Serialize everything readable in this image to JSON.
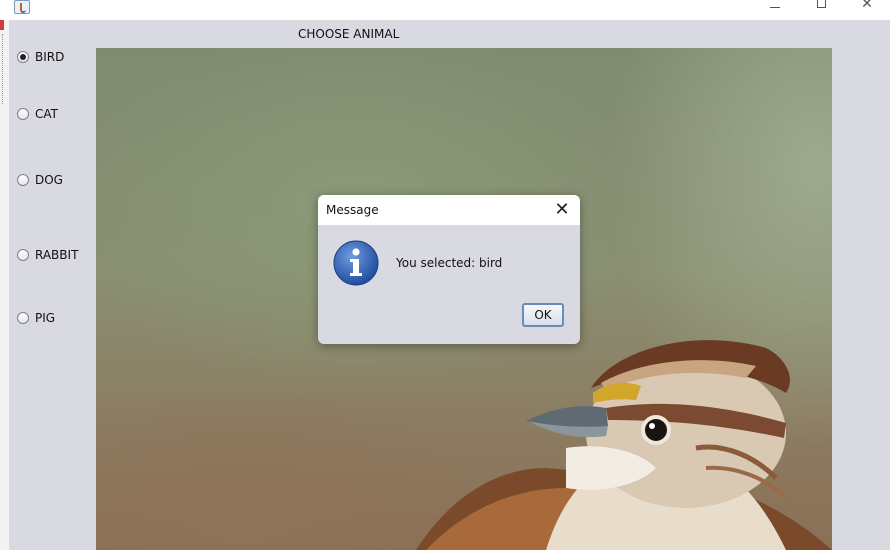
{
  "window": {
    "app_icon": "java-cup-icon",
    "controls": {
      "minimize": "minimize-icon",
      "maximize": "maximize-icon",
      "close": "close-icon"
    }
  },
  "main": {
    "heading": "CHOOSE ANIMAL",
    "options": [
      {
        "label": "BIRD",
        "checked": true
      },
      {
        "label": "CAT",
        "checked": false
      },
      {
        "label": "DOG",
        "checked": false
      },
      {
        "label": "RABBIT",
        "checked": false
      },
      {
        "label": "PIG",
        "checked": false
      }
    ],
    "selected": "BIRD",
    "image_subject": "sparrow-photo"
  },
  "dialog": {
    "title": "Message",
    "message": "You selected: bird",
    "ok_label": "OK",
    "icon": "info-icon"
  },
  "colors": {
    "panel_bg": "#d8d9e1",
    "dialog_bg": "#d8d9e1",
    "ok_border": "#6a8bb8",
    "info_blue": "#2f5fb0"
  }
}
